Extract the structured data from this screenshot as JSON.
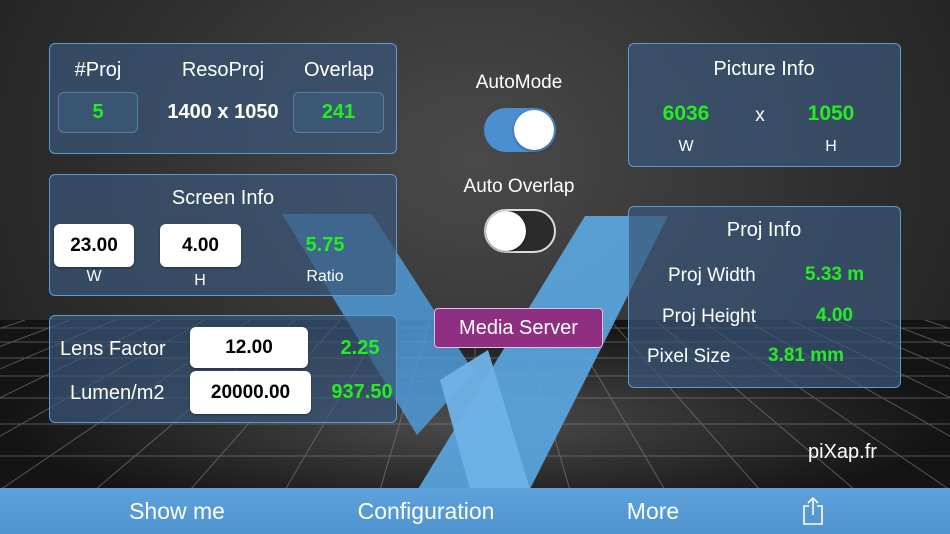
{
  "proj_panel": {
    "count_label": "#Proj",
    "reso_label": "ResoProj",
    "overlap_label": "Overlap",
    "count_value": "5",
    "reso_value": "1400 x 1050",
    "overlap_value": "241"
  },
  "screen_info": {
    "title": "Screen Info",
    "width_value": "23.00",
    "height_value": "4.00",
    "ratio_value": "5.75",
    "width_label": "W",
    "height_label": "H",
    "ratio_label": "Ratio"
  },
  "lens_panel": {
    "lens_label": "Lens Factor",
    "lens_value": "12.00",
    "lens_result": "2.25",
    "lumen_label": "Lumen/m2",
    "lumen_value": "20000.00",
    "lumen_result": "937.50"
  },
  "toggles": {
    "automode_label": "AutoMode",
    "automode_on": true,
    "autooverlap_label": "Auto Overlap",
    "autooverlap_on": false
  },
  "media_server_label": "Media Server",
  "picture_info": {
    "title": "Picture Info",
    "width_value": "6036",
    "separator": "x",
    "height_value": "1050",
    "width_label": "W",
    "height_label": "H"
  },
  "proj_info": {
    "title": "Proj Info",
    "width_label": "Proj Width",
    "width_value": "5.33 m",
    "height_label": "Proj Height",
    "height_value": "4.00",
    "pixel_label": "Pixel Size",
    "pixel_value": "3.81 mm"
  },
  "watermark": "piXap.fr",
  "tabbar": {
    "show_me": "Show me",
    "configuration": "Configuration",
    "more": "More",
    "share_icon": "share-icon"
  },
  "colors": {
    "accent_blue": "#4c8fd0",
    "value_green": "#22ee22",
    "media_button": "#8e2f82",
    "panel_border": "#5b9bd5"
  }
}
